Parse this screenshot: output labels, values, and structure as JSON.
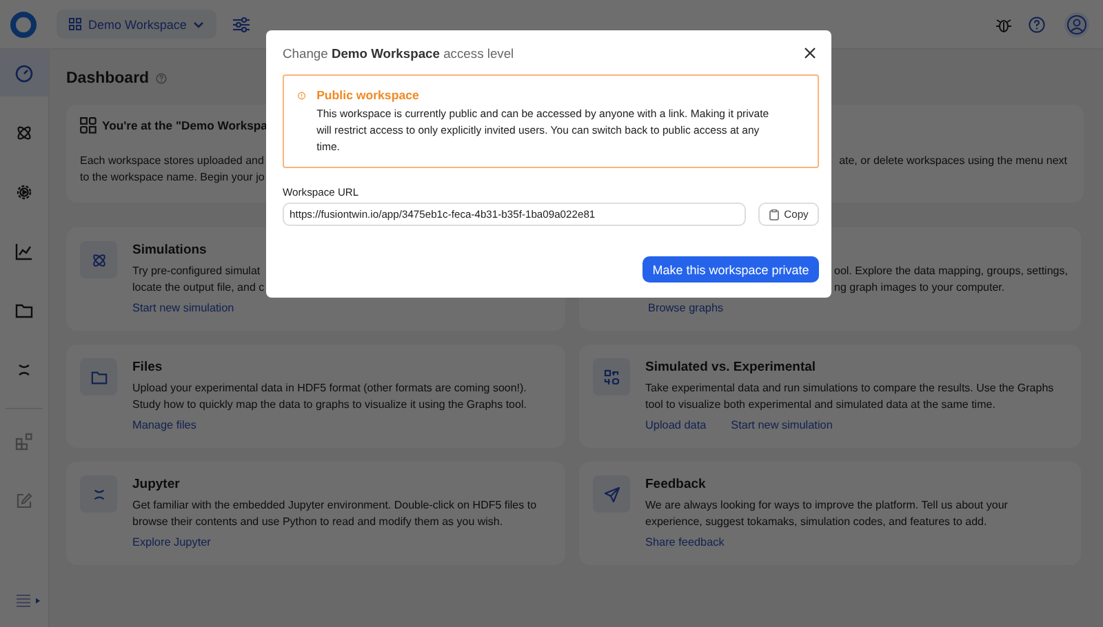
{
  "topbar": {
    "workspace": "Demo Workspace"
  },
  "sidebar": {
    "items": [
      {
        "selected": true,
        "disabled": false
      },
      {
        "selected": false,
        "disabled": false
      },
      {
        "selected": false,
        "disabled": false
      },
      {
        "selected": false,
        "disabled": false
      },
      {
        "selected": false,
        "disabled": false
      },
      {
        "selected": false,
        "disabled": false
      },
      {
        "selected": false,
        "disabled": true
      },
      {
        "selected": false,
        "disabled": true
      }
    ]
  },
  "dashboard": {
    "title": "Dashboard",
    "intro": {
      "title": "You're at the \"Demo Workspa",
      "lines": [
        {
          "left": "Each workspace stores uploaded and",
          "right": "ate, or delete workspaces using the menu next"
        },
        {
          "left": "to the workspace name. Begin your jo"
        }
      ]
    },
    "cards": [
      {
        "title": "Simulations",
        "lines": [
          "Try pre-configured simulat",
          "locate the output file, and c"
        ],
        "links": [
          "Start new simulation"
        ]
      },
      {
        "lines": [
          "ool. Explore the data mapping, groups, settings,",
          "ng graph images to your computer."
        ],
        "links": [
          "Browse graphs"
        ]
      },
      {
        "title": "Files",
        "lines": [
          "Upload your experimental data in HDF5 format (other formats are coming soon!).",
          "Study how to quickly map the data to graphs to visualize it using the Graphs tool."
        ],
        "links": [
          "Manage files"
        ]
      },
      {
        "title": "Simulated vs. Experimental",
        "lines": [
          "Take experimental data and run simulations to compare the results. Use the Graphs",
          "tool to visualize both experimental and simulated data at the same time."
        ],
        "links": [
          "Upload data",
          "Start new simulation"
        ]
      },
      {
        "title": "Jupyter",
        "lines": [
          "Get familiar with the embedded Jupyter environment. Double-click on HDF5 files to",
          "browse their contents and use Python to read and modify them as you wish."
        ],
        "links": [
          "Explore Jupyter"
        ]
      },
      {
        "title": "Feedback",
        "lines": [
          "We are always looking for ways to improve the platform. Tell us about your",
          "experience, suggest tokamaks, simulation codes, and features to add."
        ],
        "links": [
          "Share feedback"
        ]
      }
    ]
  },
  "modal": {
    "title": "Change **Demo Workspace** access level",
    "alert": {
      "title": "Public workspace",
      "text": "This workspace is currently public and can be accessed by anyone with a link. Making it private will restrict access to only explicitly invited users. You can switch back to public access at any time."
    },
    "url_label": "Workspace URL",
    "url": "https://fusiontwin.io/app/3475eb1c-feca-4b31-b35f-1ba09a022e81",
    "copy": "Copy",
    "primary": "Make this workspace private"
  }
}
